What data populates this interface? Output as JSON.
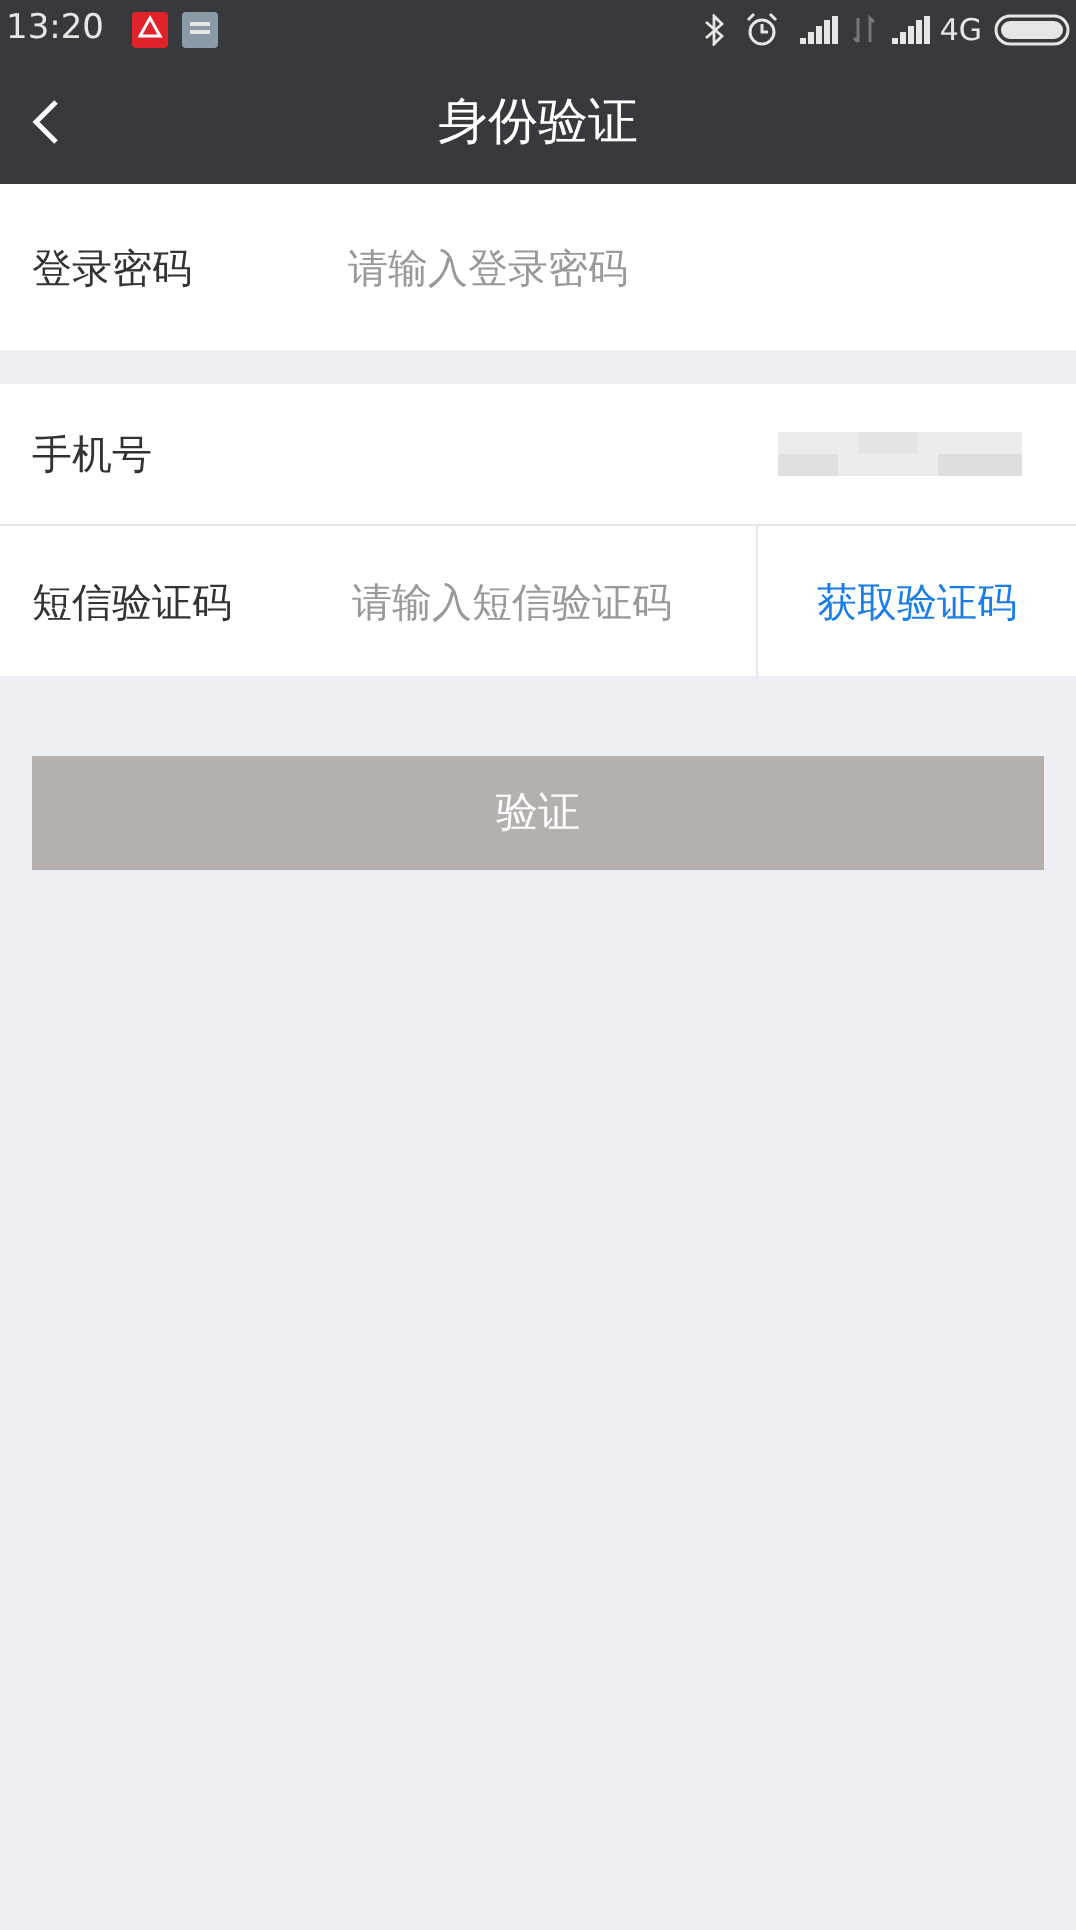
{
  "status_bar": {
    "time": "13:20",
    "network": "4G"
  },
  "header": {
    "title": "身份验证"
  },
  "password": {
    "label": "登录密码",
    "placeholder": "请输入登录密码"
  },
  "phone": {
    "label": "手机号"
  },
  "sms": {
    "label": "短信验证码",
    "placeholder": "请输入短信验证码",
    "action": "获取验证码"
  },
  "submit": {
    "label": "验证",
    "disabled": true
  }
}
